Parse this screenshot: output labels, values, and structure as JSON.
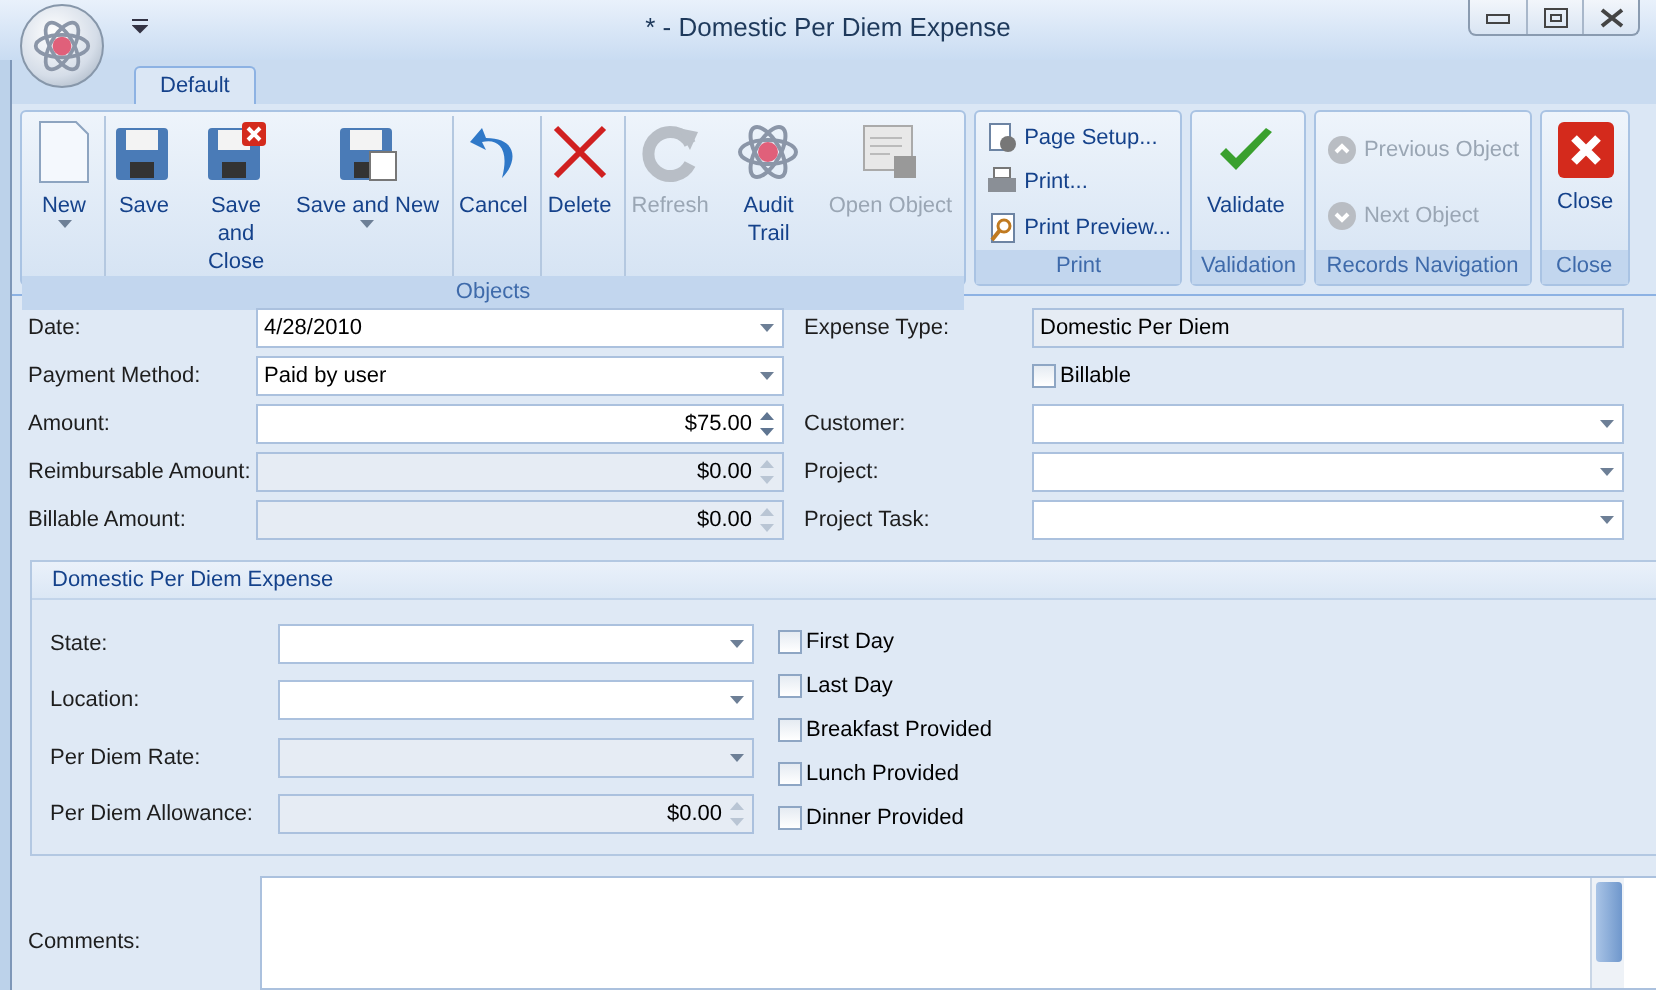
{
  "window": {
    "title": "*  - Domestic Per Diem Expense"
  },
  "ribbon": {
    "tabs": [
      {
        "label": "Default",
        "selected": true
      }
    ],
    "groups": [
      {
        "caption": "Objects",
        "buttons": [
          {
            "label": "New",
            "kind": "large",
            "disabled": false,
            "dropdown": true,
            "wrap": false,
            "separator": false
          },
          {
            "label": "Save",
            "kind": "large",
            "disabled": false,
            "dropdown": false,
            "wrap": false,
            "separator": true
          },
          {
            "label": "Save and Close",
            "kind": "large",
            "disabled": false,
            "dropdown": false,
            "wrap": true,
            "separator": false
          },
          {
            "label": "Save and New",
            "kind": "large",
            "disabled": false,
            "dropdown": true,
            "wrap": false,
            "separator": false
          },
          {
            "label": "Cancel",
            "kind": "large",
            "disabled": false,
            "dropdown": false,
            "wrap": false,
            "separator": true
          },
          {
            "label": "Delete",
            "kind": "large",
            "disabled": false,
            "dropdown": false,
            "wrap": false,
            "separator": true
          },
          {
            "label": "Refresh",
            "kind": "large",
            "disabled": true,
            "dropdown": false,
            "wrap": false,
            "separator": true
          },
          {
            "label": "Audit Trail",
            "kind": "large",
            "disabled": false,
            "dropdown": false,
            "wrap": true,
            "separator": false
          },
          {
            "label": "Open Object",
            "kind": "large",
            "disabled": true,
            "dropdown": false,
            "wrap": false,
            "separator": false
          }
        ]
      },
      {
        "caption": "Print",
        "buttons": [
          {
            "label": "Page Setup...",
            "kind": "small",
            "disabled": false
          },
          {
            "label": "Print...",
            "kind": "small",
            "disabled": false
          },
          {
            "label": "Print Preview...",
            "kind": "small",
            "disabled": false
          }
        ]
      },
      {
        "caption": "Validation",
        "buttons": [
          {
            "label": "Validate",
            "kind": "large",
            "disabled": false,
            "dropdown": false,
            "wrap": false,
            "separator": false
          }
        ]
      },
      {
        "caption": "Records Navigation",
        "buttons": [
          {
            "label": "Previous Object",
            "kind": "small",
            "disabled": true
          },
          {
            "label": "Next Object",
            "kind": "small",
            "disabled": true
          }
        ]
      },
      {
        "caption": "Close",
        "buttons": [
          {
            "label": "Close",
            "kind": "large",
            "disabled": false,
            "dropdown": false,
            "wrap": false,
            "separator": false
          }
        ]
      }
    ]
  },
  "form": {
    "left": [
      {
        "label": "Date:",
        "value": "4/28/2010",
        "kind": "combo",
        "disabled": false
      },
      {
        "label": "Payment Method:",
        "value": "Paid by user",
        "kind": "combo",
        "disabled": false
      },
      {
        "label": "Amount:",
        "value": "$75.00",
        "kind": "spin",
        "disabled": false
      },
      {
        "label": "Reimbursable Amount:",
        "value": "$0.00",
        "kind": "spin",
        "disabled": true
      },
      {
        "label": "Billable Amount:",
        "value": "$0.00",
        "kind": "spin",
        "disabled": true
      }
    ],
    "right": [
      {
        "label": "Expense Type:",
        "value": "Domestic Per Diem",
        "kind": "text",
        "disabled": true
      },
      {
        "label": "Billable",
        "kind": "checkbox",
        "checked": false
      },
      {
        "label": "Customer:",
        "kind": "combo",
        "disabled": false
      },
      {
        "label": "Project:",
        "kind": "combo",
        "disabled": false
      },
      {
        "label": "Project Task:",
        "kind": "combo",
        "disabled": false
      }
    ]
  },
  "per_diem": {
    "title": "Domestic Per Diem Expense",
    "fields": [
      {
        "label": "State:",
        "kind": "combo",
        "disabled": false
      },
      {
        "label": "Location:",
        "kind": "combo",
        "disabled": false
      },
      {
        "label": "Per Diem Rate:",
        "kind": "combo",
        "disabled": true
      },
      {
        "label": "Per Diem Allowance:",
        "value": "$0.00",
        "kind": "spin",
        "disabled": true
      }
    ],
    "checks": [
      {
        "label": "First Day",
        "checked": false
      },
      {
        "label": "Last Day",
        "checked": false
      },
      {
        "label": "Breakfast Provided",
        "checked": false
      },
      {
        "label": "Lunch Provided",
        "checked": false
      },
      {
        "label": "Dinner Provided",
        "checked": false
      }
    ]
  },
  "comments": {
    "label": "Comments:"
  }
}
